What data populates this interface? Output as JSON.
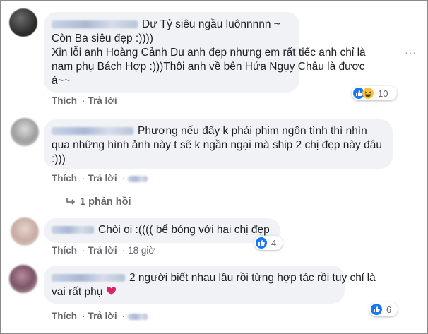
{
  "comments": [
    {
      "text_lines": [
        "Dư Tỷ siêu ngầu luônnnnn ~",
        "Còn Ba siêu đẹp :))))",
        "Xin lỗi anh Hoàng Cảnh Du anh đẹp nhưng em rất tiếc anh chỉ là",
        "nam phụ Bách Hợp :)))Thôi anh về bên Hứa Ngụy Châu là được",
        "á~~"
      ],
      "like": "Thích",
      "reply": "Trả lời",
      "reaction_count": "10"
    },
    {
      "text_lines": [
        "Phương nếu đây k phải phim ngôn tình thì nhìn",
        "qua những hình ảnh này t sẽ k ngần ngại mà ship 2 chị đẹp này đâu",
        ":)))"
      ],
      "like": "Thích",
      "reply": "Trả lời",
      "replies_label": "1 phản hồi"
    },
    {
      "text_lines": [
        "Chòi oi :(((( bể bóng với hai chị đẹp"
      ],
      "like": "Thích",
      "reply": "Trả lời",
      "time": "18 giờ",
      "reaction_count": "4"
    },
    {
      "text_lines": [
        "2 người biết nhau lâu rồi từng hợp tác rồi tuy chỉ là",
        "vai rất phụ"
      ],
      "like": "Thích",
      "reply": "Trả lời",
      "reaction_count": "6"
    }
  ],
  "more_options": "···",
  "colors": {
    "like": "#1877f2",
    "haha": "#f7c23b",
    "love": "#f0284a",
    "bubble": "#f0f2f5",
    "action": "#65676b"
  }
}
